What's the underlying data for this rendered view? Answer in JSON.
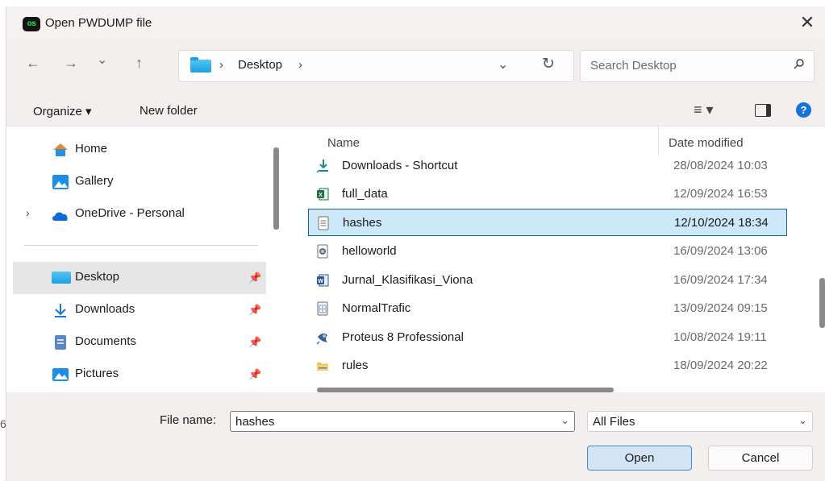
{
  "window": {
    "title": "Open PWDUMP file",
    "app_badge": "os",
    "close_glyph": "✕"
  },
  "nav": {
    "back_glyph": "←",
    "forward_glyph": "→",
    "history_glyph": "⌄",
    "up_glyph": "↑",
    "breadcrumb": [
      "Desktop"
    ],
    "separator": "›",
    "dropdown_glyph": "⌄",
    "refresh_glyph": "↻",
    "search_placeholder": "Search Desktop"
  },
  "commands": {
    "organize": "Organize ▾",
    "new_folder": "New folder",
    "view_glyph": "≡ ▾",
    "help_glyph": "?"
  },
  "sidebar": {
    "items": [
      {
        "label": "Home",
        "icon": "home-icon"
      },
      {
        "label": "Gallery",
        "icon": "gallery-icon"
      },
      {
        "label": "OneDrive - Personal",
        "icon": "onedrive-icon"
      },
      {
        "label": "Desktop",
        "icon": "desktop-folder-icon",
        "selected": true,
        "pinned": true
      },
      {
        "label": "Downloads",
        "icon": "download-icon",
        "pinned": true
      },
      {
        "label": "Documents",
        "icon": "documents-icon",
        "pinned": true
      },
      {
        "label": "Pictures",
        "icon": "pictures-icon",
        "pinned": true
      }
    ],
    "pin_glyph": "📌",
    "expand_glyph": "›"
  },
  "filelist": {
    "columns": {
      "name": "Name",
      "date": "Date modified",
      "sort_glyph": "^"
    },
    "files": [
      {
        "name": "Downloads - Shortcut",
        "date": "28/08/2024 10:03",
        "icon": "shortcut-download-icon"
      },
      {
        "name": "full_data",
        "date": "12/09/2024 16:53",
        "icon": "excel-file-icon"
      },
      {
        "name": "hashes",
        "date": "12/10/2024 18:34",
        "icon": "text-file-icon",
        "selected": true
      },
      {
        "name": "helloworld",
        "date": "16/09/2024 13:06",
        "icon": "python-file-icon"
      },
      {
        "name": "Jurnal_Klasifikasi_Viona",
        "date": "16/09/2024 17:34",
        "icon": "word-file-icon"
      },
      {
        "name": "NormalTrafic",
        "date": "13/09/2024 09:15",
        "icon": "csv-file-icon"
      },
      {
        "name": "Proteus 8 Professional",
        "date": "10/08/2024 19:11",
        "icon": "proteus-shortcut-icon"
      },
      {
        "name": "rules",
        "date": "18/09/2024 20:22",
        "icon": "folder-icon"
      }
    ]
  },
  "footer": {
    "file_name_label": "File name:",
    "file_name_value": "hashes",
    "file_type": "All Files",
    "open_label": "Open",
    "cancel_label": "Cancel",
    "dropdown_glyph": "⌄"
  },
  "edge_text": "6",
  "colors": {
    "accent": "#1473d9",
    "selection_bg": "#cde8f9",
    "selection_border": "#1b5f93",
    "chrome_bg": "#f3efee",
    "folder_blue": "#1e9fe0"
  }
}
